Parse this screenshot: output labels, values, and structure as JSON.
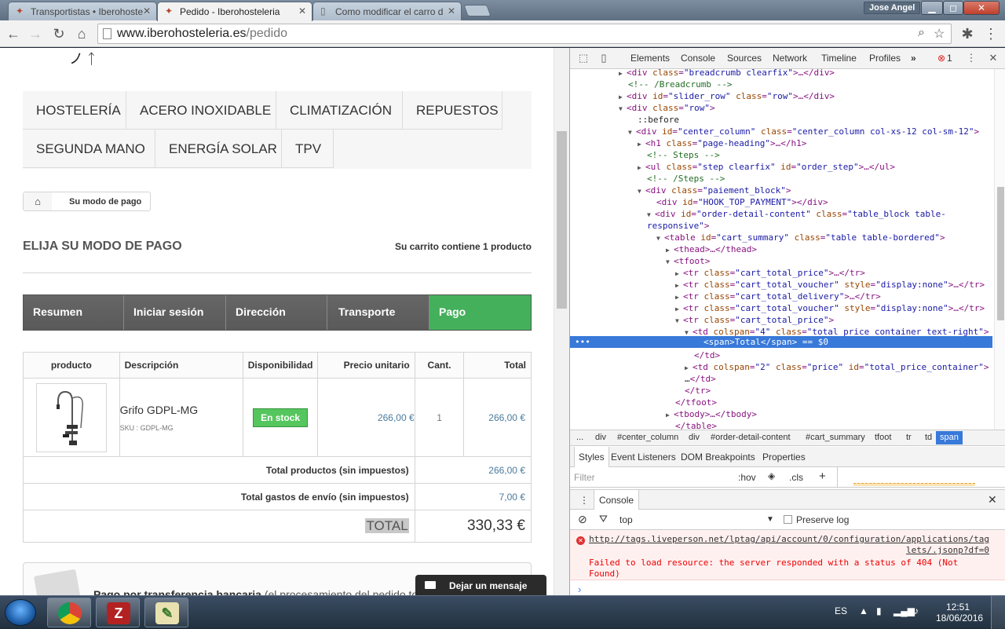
{
  "browser": {
    "tabs": [
      {
        "title": "Transportistas • Iberohoste",
        "active": false
      },
      {
        "title": "Pedido - Iberohosteleria",
        "active": true
      },
      {
        "title": "Como modificar el carro d",
        "active": false
      }
    ],
    "user_name": "Jose Angel",
    "window_buttons": [
      "▁",
      "◻",
      "✕"
    ],
    "url_host": "www.iberohosteleria.es",
    "url_path": "/pedido"
  },
  "page": {
    "categories": [
      "HOSTELERÍA",
      "ACERO INOXIDABLE",
      "CLIMATIZACIÓN",
      "REPUESTOS",
      "SEGUNDA MANO",
      "ENERGÍA SOLAR",
      "TPV"
    ],
    "breadcrumb": "Su modo de pago",
    "heading": "ELIJA SU MODO DE PAGO",
    "cart_count": "Su carrito contiene 1 producto",
    "steps": [
      "Resumen",
      "Iniciar sesión",
      "Dirección",
      "Transporte",
      "Pago"
    ],
    "current_step": "Pago",
    "table": {
      "headers": [
        "producto",
        "Descripción",
        "Disponibilidad",
        "Precio unitario",
        "Cant.",
        "Total"
      ],
      "item": {
        "name": "Grifo GDPL-MG",
        "sku": "SKU : GDPL-MG",
        "availability": "En stock",
        "unit_price": "266,00 €",
        "qty": "1",
        "total": "266,00 €"
      },
      "total_products_label": "Total productos (sin impuestos)",
      "total_products": "266,00 €",
      "shipping_label": "Total gastos de envío (sin impuestos)",
      "shipping": "7,00 €",
      "total_label": "TOTAL",
      "total": "330,33 €"
    },
    "payment_option": {
      "title": "Pago por transferencia bancaria",
      "note": "(el procesamiento del pedido tomará más"
    },
    "chat_label": "Dejar un mensaje"
  },
  "devtools": {
    "tabs": [
      "Elements",
      "Console",
      "Sources",
      "Network",
      "Timeline",
      "Profiles"
    ],
    "error_count": "1",
    "breadcrumbs": [
      "...",
      "div",
      "#center_column",
      "div",
      "#order-detail-content",
      "#cart_summary",
      "tfoot",
      "tr",
      "td",
      "span"
    ],
    "styles_tabs": [
      "Styles",
      "Event Listeners",
      "DOM Breakpoints",
      "Properties"
    ],
    "filter_placeholder": "Filter",
    "hov": ":hov",
    "cls": ".cls",
    "console_tab": "Console",
    "context": "top",
    "preserve_log": "Preserve log",
    "error_url_line1": "http://tags.liveperson.net/lptag/api/account/0/configuration/applications/tag",
    "error_url_line2": "lets/.jsonp?df=0",
    "error_msg": "Failed to load resource: the server responded with a status of 404 (Not Found)"
  },
  "taskbar": {
    "lang": "ES",
    "time": "12:51",
    "date": "18/06/2016"
  }
}
